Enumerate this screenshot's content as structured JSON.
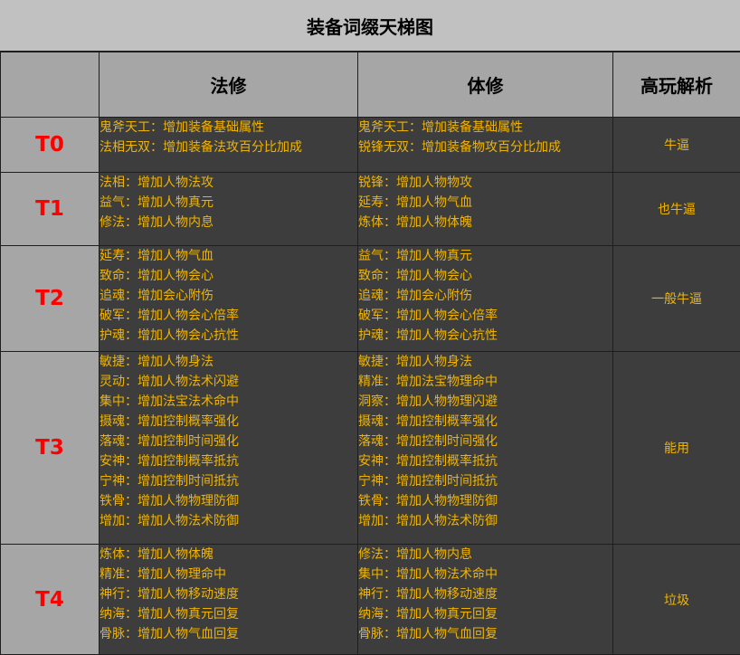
{
  "title": "装备词缀天梯图",
  "header": {
    "corner": "",
    "col_magic": "法修",
    "col_body": "体修",
    "col_analysis": "高玩解析"
  },
  "tiers": [
    {
      "tier": "T0",
      "magic": [
        "鬼斧天工：增加装备基础属性",
        "法相无双：增加装备法攻百分比加成"
      ],
      "body": [
        "鬼斧天工：增加装备基础属性",
        "锐锋无双：增加装备物攻百分比加成"
      ],
      "verdict": "牛逼"
    },
    {
      "tier": "T1",
      "magic": [
        "法相：增加人物法攻",
        "益气：增加人物真元",
        "修法：增加人物内息"
      ],
      "body": [
        "锐锋：增加人物物攻",
        "延寿：增加人物气血",
        "炼体：增加人物体魄"
      ],
      "verdict": "也牛逼"
    },
    {
      "tier": "T2",
      "magic": [
        "延寿：增加人物气血",
        "致命：增加人物会心",
        "追魂：增加会心附伤",
        "破军：增加人物会心倍率",
        "护魂：增加人物会心抗性"
      ],
      "body": [
        "益气：增加人物真元",
        "致命：增加人物会心",
        "追魂：增加会心附伤",
        "破军：增加人物会心倍率",
        "护魂：增加人物会心抗性"
      ],
      "verdict": "一般牛逼"
    },
    {
      "tier": "T3",
      "magic": [
        "敏捷：增加人物身法",
        "灵动：增加人物法术闪避",
        "集中：增加法宝法术命中",
        "摄魂：增加控制概率强化",
        "落魂：增加控制时间强化",
        "安神：增加控制概率抵抗",
        "宁神：增加控制时间抵抗",
        "铁骨：增加人物物理防御",
        "增加：增加人物法术防御"
      ],
      "body": [
        "敏捷：增加人物身法",
        "精准：增加法宝物理命中",
        "洞察：增加人物物理闪避",
        "摄魂：增加控制概率强化",
        "落魂：增加控制时间强化",
        "安神：增加控制概率抵抗",
        "宁神：增加控制时间抵抗",
        "铁骨：增加人物物理防御",
        "增加：增加人物法术防御"
      ],
      "verdict": "能用"
    },
    {
      "tier": "T4",
      "magic": [
        "炼体：增加人物体魄",
        "精准：增加人物理命中",
        "神行：增加人物移动速度",
        "纳海：增加人物真元回复",
        "骨脉：增加人物气血回复"
      ],
      "body": [
        "修法：增加人物内息",
        "集中：增加人物法术命中",
        "神行：增加人物移动速度",
        "纳海：增加人物真元回复",
        "骨脉：增加人物气血回复"
      ],
      "verdict": "垃圾"
    }
  ],
  "colors": {
    "tier_label": "#ff0000",
    "affix_text": "#f0b400",
    "cell_dark": "#3d3d3d",
    "cell_gray": "#a6a6a6",
    "title_bg": "#c1c1c1"
  }
}
